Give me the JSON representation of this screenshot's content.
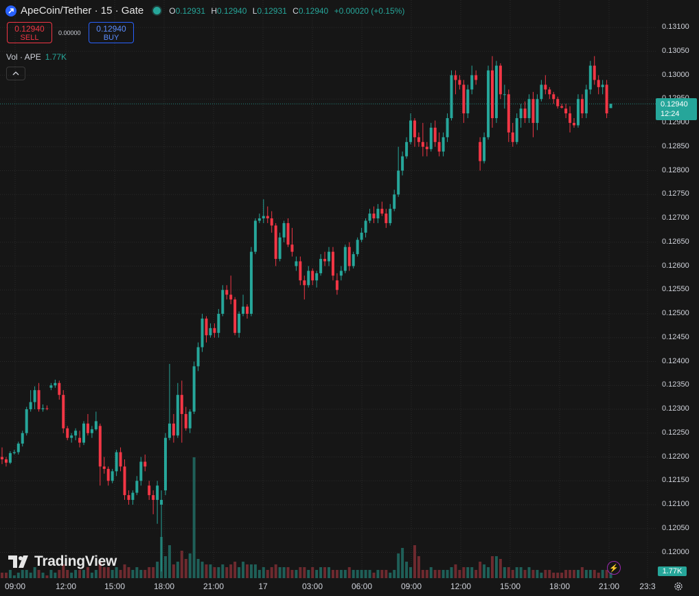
{
  "header": {
    "title": "ApeCoin/Tether · 15 · Gate",
    "ohlc": [
      {
        "k": "O",
        "v": "0.12931"
      },
      {
        "k": "H",
        "v": "0.12940"
      },
      {
        "k": "L",
        "v": "0.12931"
      },
      {
        "k": "C",
        "v": "0.12940"
      }
    ],
    "change": "+0.00020 (+0.15%)"
  },
  "trade": {
    "sell_price": "0.12940",
    "sell_label": "SELL",
    "spread": "0.00000",
    "buy_price": "0.12940",
    "buy_label": "BUY"
  },
  "volume_legend": {
    "label": "Vol · APE",
    "value": "1.77K"
  },
  "price_label": {
    "price": "0.12940",
    "countdown": "12:24"
  },
  "volume_label": "1.77K",
  "brand": "TradingView",
  "colors": {
    "up": "#26a69a",
    "down": "#f23645",
    "up_vol": "#1f5f58",
    "down_vol": "#6e2a2f",
    "background": "#161616"
  },
  "chart_data": {
    "type": "candlestick",
    "symbol": "ApeCoin/Tether",
    "interval": "15",
    "y_ticks": [
      "0.13100",
      "0.13050",
      "0.13000",
      "0.12950",
      "0.12900",
      "0.12850",
      "0.12800",
      "0.12750",
      "0.12700",
      "0.12650",
      "0.12600",
      "0.12550",
      "0.12500",
      "0.12450",
      "0.12400",
      "0.12350",
      "0.12300",
      "0.12250",
      "0.12200",
      "0.12150",
      "0.12100",
      "0.12050",
      "0.12000"
    ],
    "x_ticks": [
      "09:00",
      "12:00",
      "15:00",
      "18:00",
      "21:00",
      "17",
      "03:00",
      "06:00",
      "09:00",
      "12:00",
      "15:00",
      "18:00",
      "21:00",
      "23:3"
    ],
    "candles": [
      [
        0.122,
        0.1222,
        0.12185,
        0.12195,
        2
      ],
      [
        0.12195,
        0.122,
        0.1218,
        0.12188,
        2
      ],
      [
        0.12188,
        0.12212,
        0.12185,
        0.12208,
        3
      ],
      [
        0.12208,
        0.12215,
        0.12205,
        0.1221,
        1
      ],
      [
        0.1221,
        0.12232,
        0.12205,
        0.12228,
        2
      ],
      [
        0.12228,
        0.12255,
        0.12222,
        0.1225,
        3
      ],
      [
        0.1225,
        0.12305,
        0.12245,
        0.123,
        3
      ],
      [
        0.123,
        0.1234,
        0.12295,
        0.12315,
        2
      ],
      [
        0.12315,
        0.12348,
        0.123,
        0.1234,
        4
      ],
      [
        0.1234,
        0.12355,
        0.12295,
        0.123,
        3
      ],
      [
        0.123,
        0.1231,
        0.12295,
        0.12302,
        2
      ],
      [
        0.12302,
        0.12308,
        0.12298,
        0.12301,
        1
      ],
      [
        0.12345,
        0.12355,
        0.1234,
        0.1235,
        3
      ],
      [
        0.1235,
        0.12362,
        0.12345,
        0.12355,
        2
      ],
      [
        0.12355,
        0.1236,
        0.1232,
        0.1233,
        3
      ],
      [
        0.1233,
        0.1234,
        0.1225,
        0.1226,
        5
      ],
      [
        0.1226,
        0.12265,
        0.12235,
        0.1224,
        3
      ],
      [
        0.1224,
        0.1225,
        0.1223,
        0.12245,
        2
      ],
      [
        0.12245,
        0.1226,
        0.12235,
        0.12255,
        3
      ],
      [
        0.1224,
        0.12255,
        0.1222,
        0.1223,
        3
      ],
      [
        0.1223,
        0.12275,
        0.12225,
        0.1227,
        3
      ],
      [
        0.1227,
        0.1229,
        0.12245,
        0.1225,
        4
      ],
      [
        0.1225,
        0.12265,
        0.1224,
        0.12258,
        2
      ],
      [
        0.12258,
        0.12295,
        0.12255,
        0.12275,
        3
      ],
      [
        0.12265,
        0.1227,
        0.1214,
        0.1218,
        6
      ],
      [
        0.1218,
        0.122,
        0.12165,
        0.12175,
        4
      ],
      [
        0.12175,
        0.1218,
        0.1214,
        0.1215,
        4
      ],
      [
        0.1215,
        0.12175,
        0.12145,
        0.1217,
        3
      ],
      [
        0.1217,
        0.12215,
        0.1216,
        0.1221,
        4
      ],
      [
        0.1221,
        0.1222,
        0.1217,
        0.1218,
        3
      ],
      [
        0.1218,
        0.12195,
        0.1211,
        0.1212,
        5
      ],
      [
        0.1212,
        0.1213,
        0.121,
        0.1211,
        4
      ],
      [
        0.1211,
        0.1213,
        0.121,
        0.12125,
        3
      ],
      [
        0.12125,
        0.1216,
        0.1212,
        0.1215,
        4
      ],
      [
        0.1215,
        0.122,
        0.1214,
        0.1219,
        3
      ],
      [
        0.1219,
        0.12205,
        0.1217,
        0.1218,
        3
      ],
      [
        0.1214,
        0.1215,
        0.1211,
        0.1212,
        4
      ],
      [
        0.1212,
        0.1213,
        0.1208,
        0.1211,
        4
      ],
      [
        0.1211,
        0.1215,
        0.1206,
        0.1214,
        6
      ],
      [
        0.121,
        0.1213,
        0.1196,
        0.1211,
        15
      ],
      [
        0.1213,
        0.1225,
        0.1212,
        0.1224,
        8
      ],
      [
        0.1224,
        0.12395,
        0.12235,
        0.1227,
        12
      ],
      [
        0.1227,
        0.1229,
        0.1223,
        0.12245,
        5
      ],
      [
        0.12245,
        0.12355,
        0.1224,
        0.1233,
        6
      ],
      [
        0.1233,
        0.1236,
        0.1223,
        0.1229,
        10
      ],
      [
        0.1229,
        0.12305,
        0.12255,
        0.1226,
        7
      ],
      [
        0.1226,
        0.123,
        0.1225,
        0.12295,
        9
      ],
      [
        0.12295,
        0.124,
        0.1229,
        0.1239,
        44
      ],
      [
        0.1239,
        0.1244,
        0.1238,
        0.1243,
        7
      ],
      [
        0.1243,
        0.125,
        0.1242,
        0.1249,
        6
      ],
      [
        0.1249,
        0.12495,
        0.1244,
        0.12455,
        5
      ],
      [
        0.12455,
        0.1248,
        0.1245,
        0.1247,
        5
      ],
      [
        0.1247,
        0.1248,
        0.1245,
        0.1246,
        4
      ],
      [
        0.1246,
        0.1251,
        0.1245,
        0.125,
        4
      ],
      [
        0.125,
        0.1256,
        0.12495,
        0.1255,
        5
      ],
      [
        0.1255,
        0.1256,
        0.1253,
        0.1254,
        4
      ],
      [
        0.1254,
        0.1258,
        0.1252,
        0.1253,
        5
      ],
      [
        0.1253,
        0.12535,
        0.12455,
        0.1246,
        6
      ],
      [
        0.1246,
        0.12505,
        0.1245,
        0.125,
        4
      ],
      [
        0.125,
        0.1254,
        0.12495,
        0.12515,
        6
      ],
      [
        0.12515,
        0.1252,
        0.1249,
        0.125,
        5
      ],
      [
        0.125,
        0.1264,
        0.12495,
        0.1263,
        5
      ],
      [
        0.1263,
        0.127,
        0.12625,
        0.12695,
        5
      ],
      [
        0.12695,
        0.1271,
        0.1269,
        0.127,
        3
      ],
      [
        0.127,
        0.1274,
        0.1269,
        0.12705,
        4
      ],
      [
        0.12705,
        0.12725,
        0.1269,
        0.127,
        3
      ],
      [
        0.127,
        0.12715,
        0.1267,
        0.12685,
        4
      ],
      [
        0.12685,
        0.1269,
        0.126,
        0.12615,
        5
      ],
      [
        0.12615,
        0.1267,
        0.1261,
        0.1266,
        4
      ],
      [
        0.1266,
        0.12695,
        0.1265,
        0.1269,
        4
      ],
      [
        0.1269,
        0.127,
        0.1264,
        0.12645,
        4
      ],
      [
        0.12645,
        0.1268,
        0.1262,
        0.1263,
        3
      ],
      [
        0.126,
        0.1262,
        0.1259,
        0.1261,
        3
      ],
      [
        0.1261,
        0.1262,
        0.1256,
        0.1257,
        4
      ],
      [
        0.1257,
        0.1258,
        0.1253,
        0.1256,
        4
      ],
      [
        0.1256,
        0.126,
        0.12555,
        0.1259,
        3
      ],
      [
        0.1259,
        0.12595,
        0.1256,
        0.1257,
        4
      ],
      [
        0.1257,
        0.1259,
        0.12555,
        0.12585,
        3
      ],
      [
        0.12585,
        0.12625,
        0.1258,
        0.12615,
        4
      ],
      [
        0.12615,
        0.1263,
        0.126,
        0.1261,
        4
      ],
      [
        0.1261,
        0.1264,
        0.126,
        0.1263,
        4
      ],
      [
        0.1263,
        0.1264,
        0.1257,
        0.1258,
        3
      ],
      [
        0.1257,
        0.12585,
        0.1254,
        0.1255,
        3
      ],
      [
        0.1258,
        0.126,
        0.1257,
        0.1259,
        3
      ],
      [
        0.1259,
        0.12645,
        0.12585,
        0.1264,
        3
      ],
      [
        0.1264,
        0.1265,
        0.1259,
        0.126,
        4
      ],
      [
        0.126,
        0.1263,
        0.12595,
        0.12625,
        3
      ],
      [
        0.12625,
        0.1266,
        0.1262,
        0.12655,
        3
      ],
      [
        0.12655,
        0.1268,
        0.1265,
        0.1267,
        3
      ],
      [
        0.1267,
        0.127,
        0.1266,
        0.12695,
        3
      ],
      [
        0.12695,
        0.1272,
        0.1269,
        0.1271,
        3
      ],
      [
        0.1271,
        0.12725,
        0.1269,
        0.127,
        2
      ],
      [
        0.127,
        0.1273,
        0.1269,
        0.1272,
        3
      ],
      [
        0.1272,
        0.12735,
        0.12705,
        0.1271,
        3
      ],
      [
        0.1271,
        0.1272,
        0.1268,
        0.1269,
        3
      ],
      [
        0.1269,
        0.1273,
        0.12685,
        0.1272,
        2
      ],
      [
        0.1272,
        0.1276,
        0.12715,
        0.1275,
        3
      ],
      [
        0.1275,
        0.1285,
        0.12745,
        0.128,
        9
      ],
      [
        0.128,
        0.1284,
        0.1279,
        0.1283,
        11
      ],
      [
        0.1283,
        0.1287,
        0.12825,
        0.1286,
        6
      ],
      [
        0.1286,
        0.1292,
        0.12855,
        0.12905,
        4
      ],
      [
        0.12905,
        0.1291,
        0.1285,
        0.1287,
        12
      ],
      [
        0.1287,
        0.1288,
        0.1285,
        0.1286,
        8
      ],
      [
        0.1286,
        0.129,
        0.1283,
        0.1285,
        3
      ],
      [
        0.1285,
        0.1286,
        0.1283,
        0.12845,
        3
      ],
      [
        0.12845,
        0.129,
        0.1284,
        0.1289,
        4
      ],
      [
        0.1289,
        0.12905,
        0.1285,
        0.1286,
        3
      ],
      [
        0.1286,
        0.1288,
        0.1283,
        0.1284,
        3
      ],
      [
        0.1284,
        0.1288,
        0.1283,
        0.1287,
        3
      ],
      [
        0.1287,
        0.1292,
        0.1286,
        0.1291,
        3
      ],
      [
        0.1291,
        0.1301,
        0.12905,
        0.13,
        4
      ],
      [
        0.13,
        0.1301,
        0.1296,
        0.1299,
        5
      ],
      [
        0.1299,
        0.13,
        0.1297,
        0.1298,
        3
      ],
      [
        0.1298,
        0.1299,
        0.129,
        0.1292,
        4
      ],
      [
        0.1292,
        0.1298,
        0.1291,
        0.1297,
        4
      ],
      [
        0.1297,
        0.1302,
        0.1296,
        0.13,
        4
      ],
      [
        0.13,
        0.1301,
        0.1298,
        0.1299,
        3
      ],
      [
        0.1286,
        0.1287,
        0.128,
        0.1282,
        6
      ],
      [
        0.1282,
        0.1288,
        0.12815,
        0.1287,
        5
      ],
      [
        0.1287,
        0.1302,
        0.12865,
        0.1301,
        4
      ],
      [
        0.1301,
        0.1304,
        0.1289,
        0.1291,
        8
      ],
      [
        0.1291,
        0.1303,
        0.129,
        0.1302,
        8
      ],
      [
        0.1302,
        0.13025,
        0.1295,
        0.1296,
        7
      ],
      [
        0.1296,
        0.1298,
        0.1293,
        0.1296,
        4
      ],
      [
        0.1296,
        0.1297,
        0.1286,
        0.1288,
        4
      ],
      [
        0.1288,
        0.129,
        0.1285,
        0.1286,
        3
      ],
      [
        0.1286,
        0.1292,
        0.12855,
        0.1291,
        4
      ],
      [
        0.1291,
        0.1294,
        0.1289,
        0.1293,
        4
      ],
      [
        0.1293,
        0.12945,
        0.129,
        0.1291,
        3
      ],
      [
        0.1291,
        0.1296,
        0.129,
        0.1295,
        4
      ],
      [
        0.1295,
        0.12965,
        0.1287,
        0.129,
        3
      ],
      [
        0.129,
        0.1296,
        0.12885,
        0.1295,
        3
      ],
      [
        0.1295,
        0.1299,
        0.12945,
        0.1298,
        2
      ],
      [
        0.1298,
        0.13,
        0.1296,
        0.1297,
        3
      ],
      [
        0.1297,
        0.12975,
        0.1295,
        0.1296,
        3
      ],
      [
        0.1296,
        0.12965,
        0.1294,
        0.1295,
        2
      ],
      [
        0.1295,
        0.12955,
        0.1293,
        0.12935,
        2
      ],
      [
        0.12935,
        0.1294,
        0.1293,
        0.12932,
        2
      ],
      [
        0.1293,
        0.1294,
        0.1291,
        0.1292,
        3
      ],
      [
        0.1292,
        0.12935,
        0.1288,
        0.129,
        3
      ],
      [
        0.129,
        0.1291,
        0.1289,
        0.12895,
        3
      ],
      [
        0.12895,
        0.1296,
        0.1289,
        0.1295,
        3
      ],
      [
        0.1295,
        0.1296,
        0.1291,
        0.1292,
        4
      ],
      [
        0.1292,
        0.1298,
        0.1291,
        0.1297,
        3
      ],
      [
        0.1297,
        0.1303,
        0.1296,
        0.1302,
        3
      ],
      [
        0.1302,
        0.1304,
        0.1298,
        0.1299,
        3
      ],
      [
        0.1299,
        0.13,
        0.1296,
        0.12975,
        2
      ],
      [
        0.12975,
        0.1299,
        0.1296,
        0.1298,
        3
      ],
      [
        0.1298,
        0.1299,
        0.1291,
        0.1292,
        3
      ],
      [
        0.12931,
        0.1294,
        0.12931,
        0.1294,
        2
      ]
    ]
  }
}
